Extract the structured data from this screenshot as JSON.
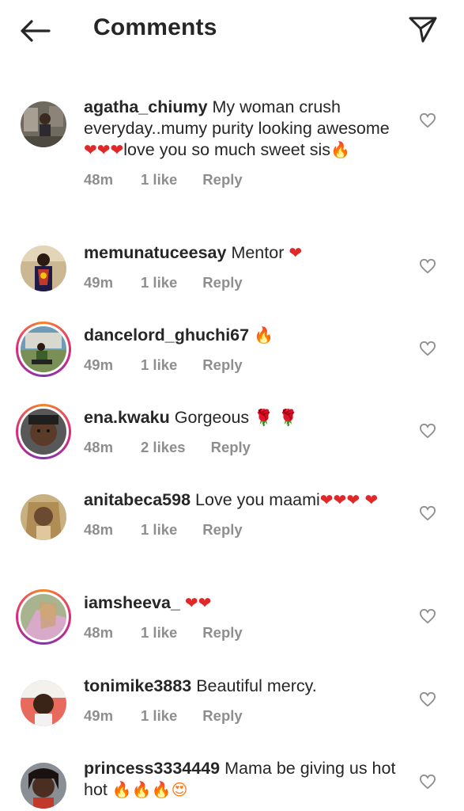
{
  "header": {
    "title": "Comments",
    "back_icon": "back-arrow-icon",
    "send_icon": "paper-plane-icon"
  },
  "colors": {
    "text": "#262626",
    "meta": "#8e8e8e",
    "story_ring_start": "#f58529",
    "story_ring_end": "#dd2a7b"
  },
  "comments": [
    {
      "username": "agatha_chiumy",
      "text": "My woman crush everyday..mumy purity looking awesome",
      "emoji_a": "❤❤❤",
      "text_b": "love you so much sweet sis",
      "emoji_b": "🔥",
      "time": "48m",
      "likes": "1 like",
      "reply": "Reply"
    },
    {
      "username": "memunatuceesay",
      "text": "Mentor",
      "emoji_a": "❤",
      "time": "49m",
      "likes": "1 like",
      "reply": "Reply"
    },
    {
      "username": "dancelord_ghuchi67",
      "text": "",
      "emoji_a": "🔥",
      "time": "49m",
      "likes": "1 like",
      "reply": "Reply"
    },
    {
      "username": "ena.kwaku",
      "text": "Gorgeous",
      "emoji_a": "🌹 🌹",
      "time": "48m",
      "likes": "2 likes",
      "reply": "Reply"
    },
    {
      "username": "anitabeca598",
      "text": "Love you maami",
      "emoji_a": "❤❤❤ ❤",
      "time": "48m",
      "likes": "1 like",
      "reply": "Reply"
    },
    {
      "username": "iamsheeva_",
      "text": "",
      "emoji_a": "❤❤",
      "time": "48m",
      "likes": "1 like",
      "reply": "Reply"
    },
    {
      "username": "tonimike3883",
      "text": "Beautiful mercy.",
      "time": "49m",
      "likes": "1 like",
      "reply": "Reply"
    },
    {
      "username": "princess3334449",
      "text": "Mama be giving us hot hot",
      "emoji_a": "🔥🔥🔥😍",
      "time": "",
      "likes": "",
      "reply": ""
    }
  ]
}
